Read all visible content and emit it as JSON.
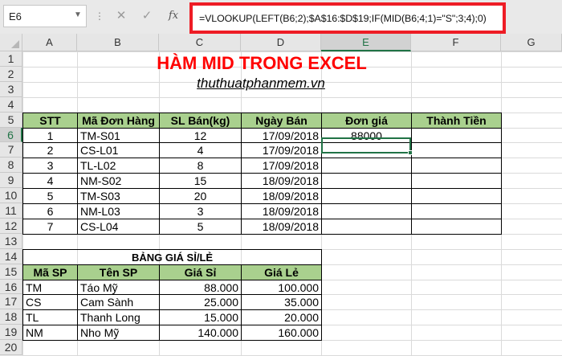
{
  "name_box": "E6",
  "formula_bar": {
    "cancel_icon": "✕",
    "enter_icon": "✓",
    "fx_label": "fx",
    "formula": "=VLOOKUP(LEFT(B6;2);$A$16:$D$19;IF(MID(B6;4;1)=\"S\";3;4);0)"
  },
  "columns": [
    "A",
    "B",
    "C",
    "D",
    "E",
    "F",
    "G"
  ],
  "rows": [
    "1",
    "2",
    "3",
    "4",
    "5",
    "6",
    "7",
    "8",
    "9",
    "10",
    "11",
    "12",
    "13",
    "14",
    "15",
    "16",
    "17",
    "18",
    "19",
    "20"
  ],
  "title": "HÀM MID TRONG EXCEL",
  "subtitle": "thuthuatphanmem.vn",
  "orders_table": {
    "headers": [
      "STT",
      "Mã Đơn Hàng",
      "SL Bán(kg)",
      "Ngày Bán",
      "Đơn giá",
      "Thành Tiền"
    ],
    "rows": [
      {
        "stt": "1",
        "code": "TM-S01",
        "qty": "12",
        "date": "17/09/2018",
        "price": "88000",
        "total": ""
      },
      {
        "stt": "2",
        "code": "CS-L01",
        "qty": "4",
        "date": "17/09/2018",
        "price": "",
        "total": ""
      },
      {
        "stt": "3",
        "code": "TL-L02",
        "qty": "8",
        "date": "17/09/2018",
        "price": "",
        "total": ""
      },
      {
        "stt": "4",
        "code": "NM-S02",
        "qty": "15",
        "date": "18/09/2018",
        "price": "",
        "total": ""
      },
      {
        "stt": "5",
        "code": "TM-S03",
        "qty": "20",
        "date": "18/09/2018",
        "price": "",
        "total": ""
      },
      {
        "stt": "6",
        "code": "NM-L03",
        "qty": "3",
        "date": "18/09/2018",
        "price": "",
        "total": ""
      },
      {
        "stt": "7",
        "code": "CS-L04",
        "qty": "5",
        "date": "18/09/2018",
        "price": "",
        "total": ""
      }
    ]
  },
  "price_table": {
    "title": "BẢNG GIÁ SỈ/LẺ",
    "headers": [
      "Mã SP",
      "Tên SP",
      "Giá Sỉ",
      "Giá Lẻ"
    ],
    "rows": [
      {
        "code": "TM",
        "name": "Táo Mỹ",
        "wholesale": "88.000",
        "retail": "100.000"
      },
      {
        "code": "CS",
        "name": "Cam Sành",
        "wholesale": "25.000",
        "retail": "35.000"
      },
      {
        "code": "TL",
        "name": "Thanh Long",
        "wholesale": "15.000",
        "retail": "20.000"
      },
      {
        "code": "NM",
        "name": "Nho Mỹ",
        "wholesale": "140.000",
        "retail": "160.000"
      }
    ]
  },
  "colors": {
    "header_fill": "#a9d08e",
    "title": "#ff0000",
    "selection": "#217346",
    "formula_highlight": "#ee1c25"
  }
}
